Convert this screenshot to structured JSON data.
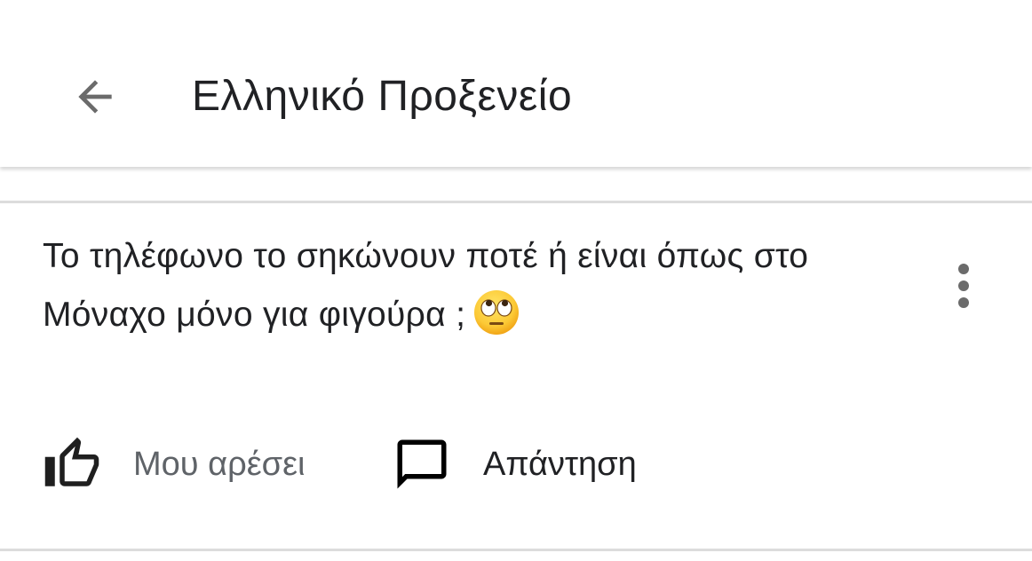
{
  "header": {
    "title": "Ελληνικό Προξενείο",
    "back_icon": "arrow-back-icon"
  },
  "comment": {
    "text": "Το τηλέφωνο το σηκώνουν ποτέ ή είναι όπως στο Μόναχο μόνο για φιγούρα ;",
    "emoji": "face-with-rolling-eyes",
    "menu_icon": "more-vertical-icon"
  },
  "actions": {
    "like_label": "Μου αρέσει",
    "like_icon": "thumb-up-icon",
    "reply_label": "Απάντηση",
    "reply_icon": "comment-icon"
  },
  "colors": {
    "text_primary": "#202124",
    "text_secondary": "#5f6368",
    "icon_gray": "#6b6b6b",
    "divider": "#dcdcdc",
    "background": "#ffffff"
  }
}
